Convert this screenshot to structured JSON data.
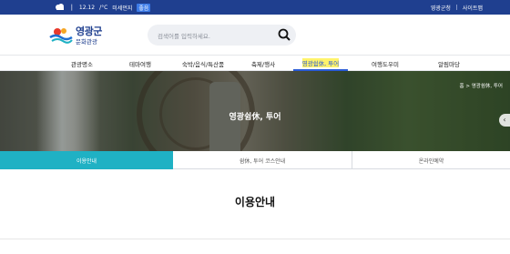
{
  "topbar": {
    "date": "12.12",
    "temperature": "/°C",
    "dust_label": "미세먼지",
    "dust_status": "좋음",
    "links": [
      "영광군청",
      "사이트맵"
    ]
  },
  "header": {
    "logo_line1": "영광군",
    "logo_line2": "문화관광",
    "search_placeholder": "검색어를 입력하세요."
  },
  "nav": {
    "items": [
      "관광명소",
      "테마여행",
      "숙박/음식/특산품",
      "축제/행사",
      "영광쉼休, 투어",
      "여행도우미",
      "알림마당"
    ],
    "active_index": 4
  },
  "hero": {
    "title": "영광쉼休, 투어",
    "breadcrumb": "홈 > 영광쉼休, 투어"
  },
  "tabs": {
    "items": [
      "이용안내",
      "쉼休, 투어 코스안내",
      "온라인예약"
    ],
    "active_index": 0
  },
  "content": {
    "title": "이용안내"
  },
  "colors": {
    "topbar": "#1f3f8f",
    "nav_active": "#2a5bd7",
    "tab_active": "#1fb1c4"
  }
}
